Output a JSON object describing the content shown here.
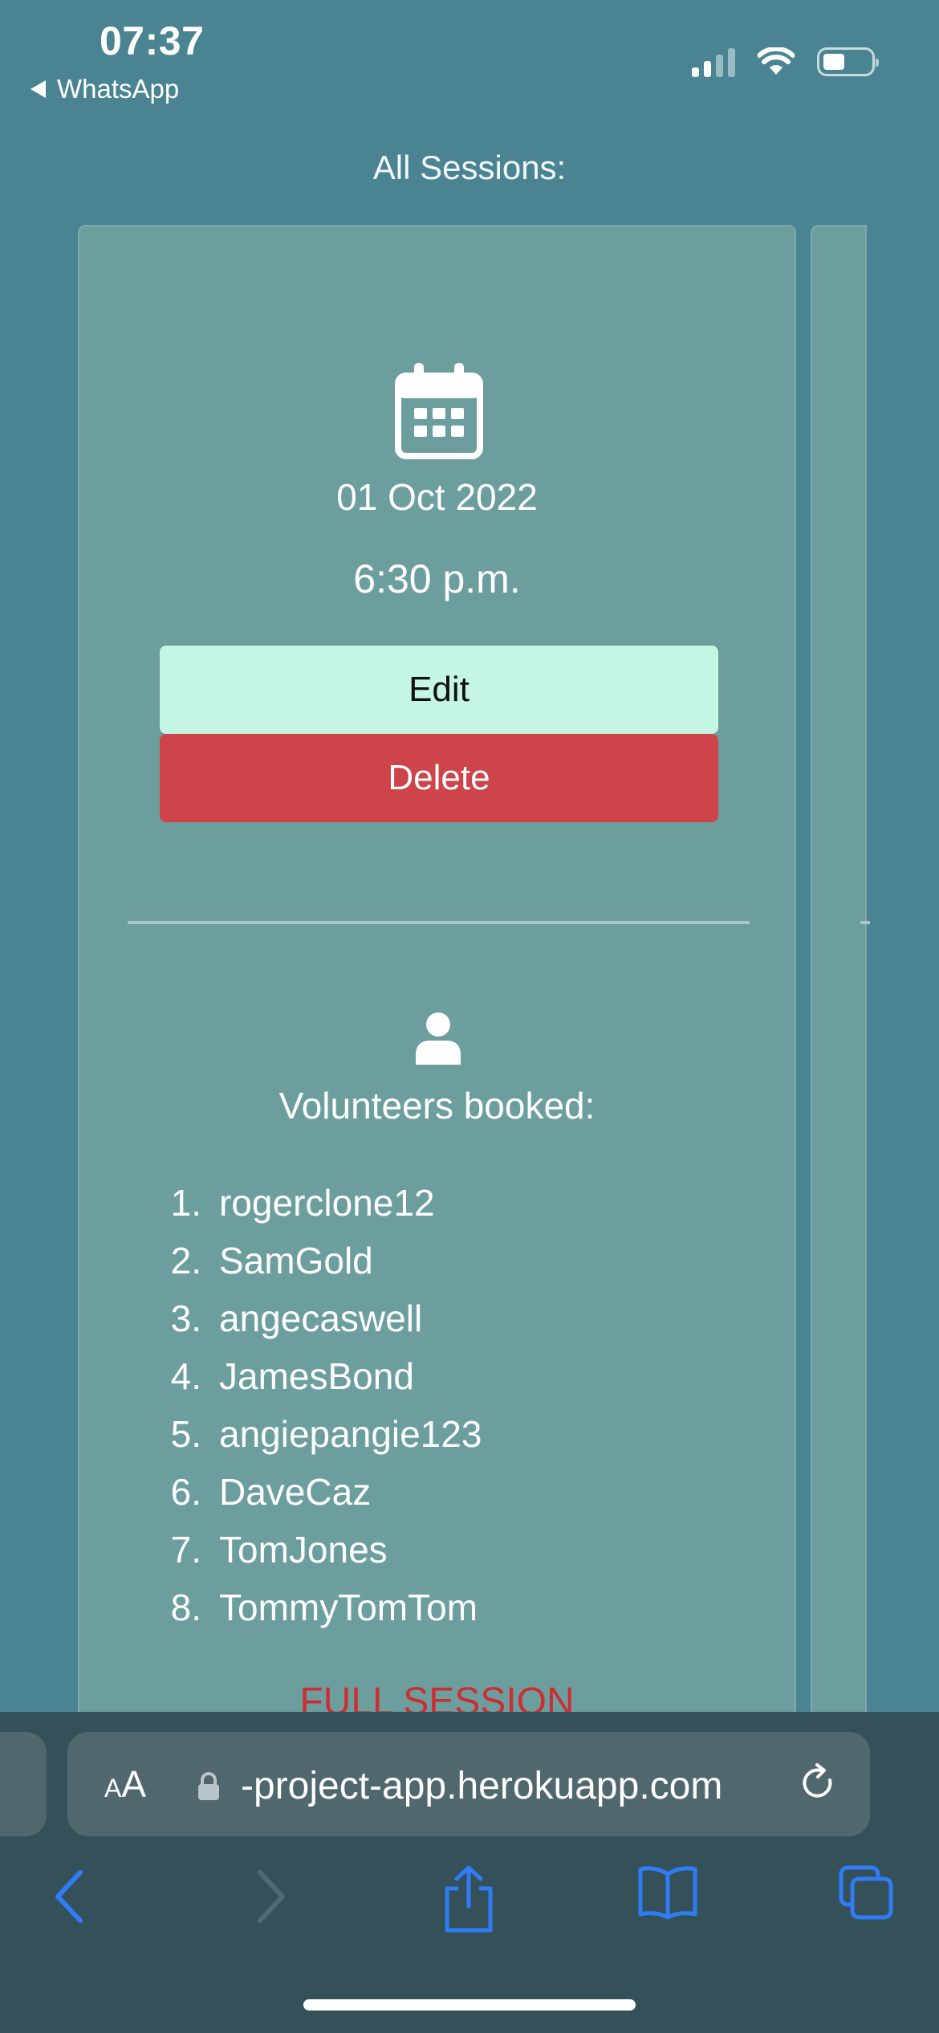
{
  "status_bar": {
    "time": "07:37",
    "back_app": "WhatsApp",
    "icons": [
      "cellular-signal-icon",
      "wifi-icon",
      "battery-icon"
    ]
  },
  "page": {
    "heading": "All Sessions:"
  },
  "session": {
    "date": "01 Oct 2022",
    "time": "6:30 p.m.",
    "edit_label": "Edit",
    "delete_label": "Delete",
    "volunteers_heading": "Volunteers booked:",
    "volunteers": [
      {
        "num": "1.",
        "name": "rogerclone12"
      },
      {
        "num": "2.",
        "name": "SamGold"
      },
      {
        "num": "3.",
        "name": "angecaswell"
      },
      {
        "num": "4.",
        "name": "JamesBond"
      },
      {
        "num": "5.",
        "name": "angiepangie123"
      },
      {
        "num": "6.",
        "name": "DaveCaz"
      },
      {
        "num": "7.",
        "name": "TomJones"
      },
      {
        "num": "8.",
        "name": "TommyTomTom"
      }
    ],
    "status": "FULL SESSION"
  },
  "browser": {
    "aa_label_small": "A",
    "aa_label_large": "A",
    "url": "-project-app.herokuapp.com",
    "nav_icons": [
      "back-icon",
      "forward-icon",
      "share-icon",
      "bookmarks-icon",
      "tabs-icon"
    ]
  },
  "colors": {
    "background": "#4a8492",
    "card": "#6d9e9e",
    "edit_button": "#c4f6e3",
    "delete_button": "#cd444b",
    "full_session": "#cc2f33",
    "toolbar": "#34515a",
    "ios_blue": "#2f7cf6"
  }
}
